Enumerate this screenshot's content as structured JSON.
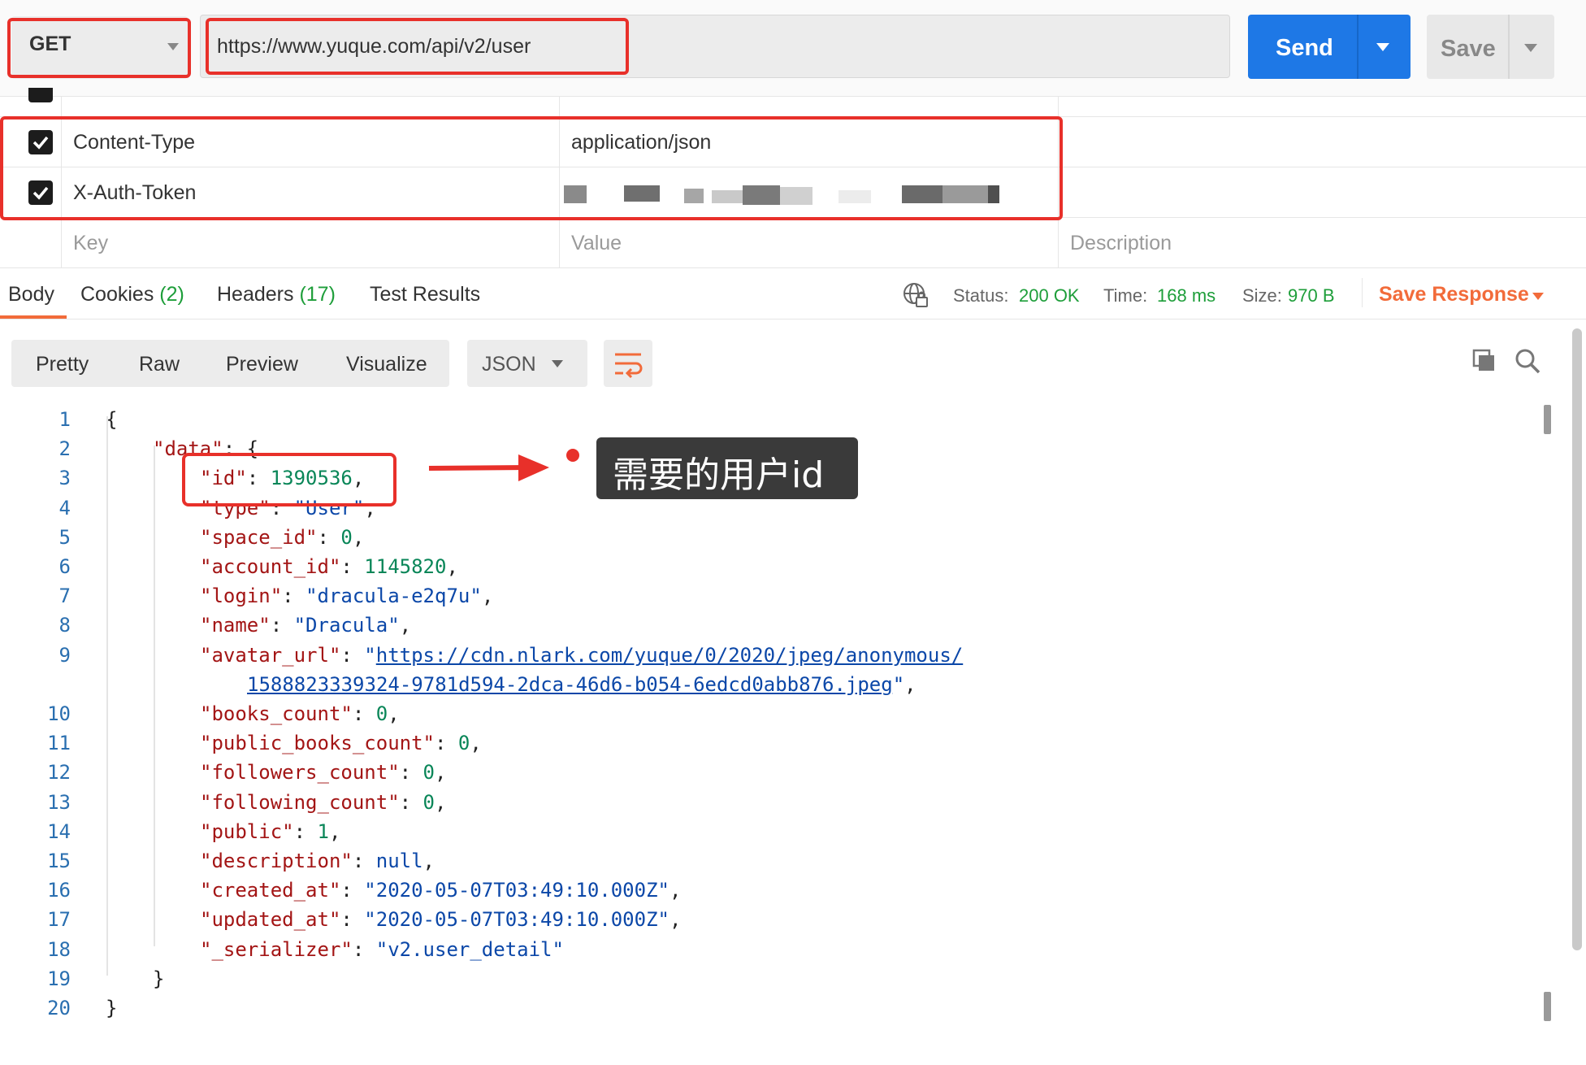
{
  "request": {
    "method": "GET",
    "url": "https://www.yuque.com/api/v2/user",
    "send_label": "Send",
    "save_label": "Save"
  },
  "headers_table": {
    "rows": [
      {
        "enabled": true,
        "key": "Content-Type",
        "value": "application/json"
      },
      {
        "enabled": true,
        "key": "X-Auth-Token",
        "value": ""
      }
    ],
    "placeholders": {
      "key": "Key",
      "value": "Value",
      "description": "Description"
    }
  },
  "response_tabs": [
    {
      "label": "Body",
      "count": ""
    },
    {
      "label": "Cookies",
      "count": "(2)"
    },
    {
      "label": "Headers",
      "count": "(17)"
    },
    {
      "label": "Test Results",
      "count": ""
    }
  ],
  "status": {
    "status_label": "Status:",
    "status_value": "200 OK",
    "time_label": "Time:",
    "time_value": "168 ms",
    "size_label": "Size:",
    "size_value": "970 B",
    "save_response": "Save Response"
  },
  "view_modes": [
    "Pretty",
    "Raw",
    "Preview",
    "Visualize"
  ],
  "format": "JSON",
  "annotation": "需要的用户id",
  "json_lines": [
    {
      "num": "1",
      "indent": 0,
      "key": "",
      "value": "{",
      "vtype": "p",
      "comma": false
    },
    {
      "num": "2",
      "indent": 1,
      "key": "data",
      "value": "{",
      "vtype": "p",
      "comma": false
    },
    {
      "num": "3",
      "indent": 2,
      "key": "id",
      "value": "1390536",
      "vtype": "n",
      "comma": true
    },
    {
      "num": "4",
      "indent": 2,
      "key": "type",
      "value": "\"User\"",
      "vtype": "s",
      "comma": true
    },
    {
      "num": "5",
      "indent": 2,
      "key": "space_id",
      "value": "0",
      "vtype": "n",
      "comma": true
    },
    {
      "num": "6",
      "indent": 2,
      "key": "account_id",
      "value": "1145820",
      "vtype": "n",
      "comma": true
    },
    {
      "num": "7",
      "indent": 2,
      "key": "login",
      "value": "\"dracula-e2q7u\"",
      "vtype": "s",
      "comma": true
    },
    {
      "num": "8",
      "indent": 2,
      "key": "name",
      "value": "\"Dracula\"",
      "vtype": "s",
      "comma": true
    },
    {
      "num": "9",
      "indent": 2,
      "key": "avatar_url",
      "value": "https://cdn.nlark.com/yuque/0/2020/jpeg/anonymous/",
      "vtype": "link",
      "comma": false
    },
    {
      "num": "",
      "indent": 3,
      "key": "",
      "value": "1588823339324-9781d594-2dca-46d6-b054-6edcd0abb876.jpeg",
      "vtype": "link",
      "comma": true,
      "closeq": true
    },
    {
      "num": "10",
      "indent": 2,
      "key": "books_count",
      "value": "0",
      "vtype": "n",
      "comma": true
    },
    {
      "num": "11",
      "indent": 2,
      "key": "public_books_count",
      "value": "0",
      "vtype": "n",
      "comma": true
    },
    {
      "num": "12",
      "indent": 2,
      "key": "followers_count",
      "value": "0",
      "vtype": "n",
      "comma": true
    },
    {
      "num": "13",
      "indent": 2,
      "key": "following_count",
      "value": "0",
      "vtype": "n",
      "comma": true
    },
    {
      "num": "14",
      "indent": 2,
      "key": "public",
      "value": "1",
      "vtype": "n",
      "comma": true
    },
    {
      "num": "15",
      "indent": 2,
      "key": "description",
      "value": "null",
      "vtype": "s",
      "comma": true
    },
    {
      "num": "16",
      "indent": 2,
      "key": "created_at",
      "value": "\"2020-05-07T03:49:10.000Z\"",
      "vtype": "s",
      "comma": true
    },
    {
      "num": "17",
      "indent": 2,
      "key": "updated_at",
      "value": "\"2020-05-07T03:49:10.000Z\"",
      "vtype": "s",
      "comma": true
    },
    {
      "num": "18",
      "indent": 2,
      "key": "_serializer",
      "value": "\"v2.user_detail\"",
      "vtype": "s",
      "comma": false
    },
    {
      "num": "19",
      "indent": 1,
      "key": "",
      "value": "}",
      "vtype": "p",
      "comma": false
    },
    {
      "num": "20",
      "indent": 0,
      "key": "",
      "value": "}",
      "vtype": "p",
      "comma": false
    }
  ]
}
